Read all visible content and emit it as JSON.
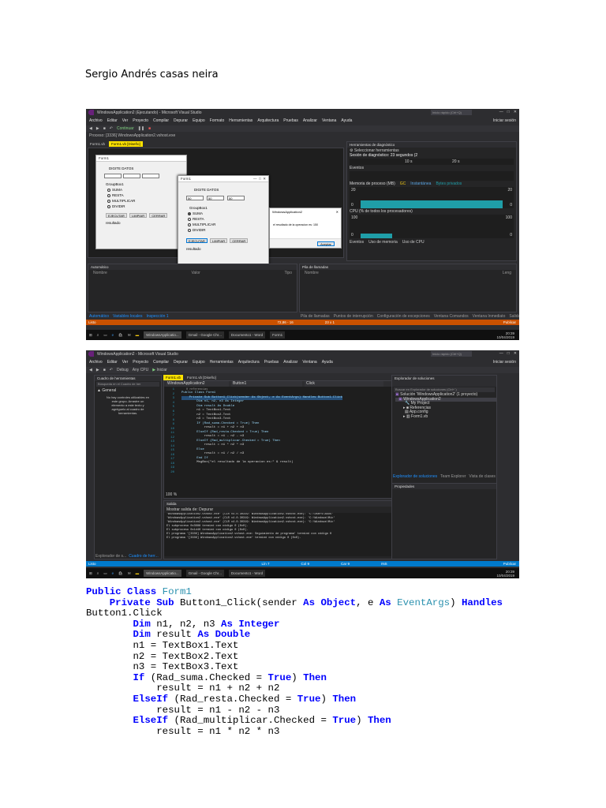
{
  "author": "Sergio Andrés casas neira",
  "shot1": {
    "title": "WindowsApplication2 (Ejecutando) - Microsoft Visual Studio",
    "menu": [
      "Archivo",
      "Editar",
      "Ver",
      "Proyecto",
      "Compilar",
      "Depurar",
      "Equipo",
      "Formato",
      "Herramientas",
      "Arquitectura",
      "Pruebas",
      "Analizar",
      "Ventana",
      "Ayuda"
    ],
    "quick_launch": "Inicio rápido (Ctrl+Q)",
    "user": "Iniciar sesión",
    "process": "Proceso: [3336] WindowsApplication2.vshost.exe",
    "continue": "Continuar",
    "form_tab": "Form1.vb",
    "form_design_tab": "Form1.vb [Diseño]",
    "form_small": {
      "title": "Form1",
      "heading": "DIGITE DATOS",
      "group": "GroupBox1",
      "radios": [
        "SUMA",
        "RESTA",
        "MULTIPLICAR",
        "DIVIDIR"
      ],
      "buttons": [
        "EJECUTAR",
        "LIMPIAR",
        "CERRAR"
      ],
      "result": "resultado"
    },
    "form_run": {
      "title": "Form1",
      "heading": "DIGITE DATOS",
      "values": [
        "50",
        "50",
        "50"
      ],
      "group": "GroupBox1",
      "radios": [
        "SUMA",
        "RESTA",
        "MULTIPLICAR",
        "DIVIDIR"
      ],
      "buttons": [
        "EJECUTAR",
        "LIMPIAR",
        "CERRAR"
      ],
      "result": "resultado"
    },
    "msgbox": {
      "title": "WindowsApplication2",
      "text": "el resultado de la operacion es: 150",
      "ok": "Aceptar"
    },
    "diag": {
      "title": "Herramientas de diagnóstico",
      "select_tools": "Seleccionar herramientas",
      "session": "Sesión de diagnóstico: 23 segundos (2",
      "t10": "10 s",
      "t20": "20 s",
      "events": "Eventos",
      "memory": "Memoria de proceso (MB)",
      "gc": "GC",
      "snapshot": "Instantánea",
      "private": "Bytes privados",
      "mem_left": "20",
      "mem_right": "20",
      "zero_left": "0",
      "zero_right": "0",
      "cpu": "CPU (% de todos los procesadores)",
      "cpu_left": "100",
      "cpu_right": "100",
      "cpu_zero_left": "0",
      "cpu_zero_right": "0",
      "tabs": [
        "Eventos",
        "Uso de memoria",
        "Uso de CPU"
      ]
    },
    "auto_title": "Automático",
    "auto_cols": [
      "Nombre",
      "Valor",
      "Tipo"
    ],
    "stack_title": "Pila de llamadas",
    "stack_cols": [
      "Nombre",
      "Leng"
    ],
    "bottom_tabs_left": [
      "Automático",
      "Variables locales",
      "Inspección 1"
    ],
    "bottom_tabs_right": [
      "Pila de llamadas",
      "Puntos de interrupción",
      "Configuración de excepciones",
      "Ventana Comandos",
      "Ventana Inmediato",
      "Salida"
    ],
    "status": "Listo",
    "status_pos": "72,86 - 16",
    "status_size": "23 x 1",
    "publish": "Publicar",
    "taskbar_apps": [
      "WindowsApplicatio...",
      "Gmail - Google Chr...",
      "Documento1 - Word",
      "Form1"
    ],
    "time": "20:39",
    "date": "10/04/2019"
  },
  "shot2": {
    "title": "WindowsApplication2 - Microsoft Visual Studio",
    "menu": [
      "Archivo",
      "Editar",
      "Ver",
      "Proyecto",
      "Compilar",
      "Depurar",
      "Equipo",
      "Herramientas",
      "Arquitectura",
      "Pruebas",
      "Analizar",
      "Ventana",
      "Ayuda"
    ],
    "quick_launch": "Inicio rápido (Ctrl+Q)",
    "user": "Iniciar sesión",
    "toolbar": [
      "Debug",
      "Any CPU",
      "Iniciar"
    ],
    "toolbox_title": "Cuadro de herramientas",
    "toolbox_search": "Búsqueda en el Cuadro de her",
    "toolbox_general": "General",
    "toolbox_msg": "No hay controles utilizables en este grupo. Arrastre un elemento a este texto y agréguelo al cuadro de herramientas.",
    "editor_tabs": [
      "Form1.vb",
      "Form1.vb [Diseño]"
    ],
    "nav_left": "WindowsApplication2",
    "nav_mid": "Button1",
    "nav_right": "Click",
    "refs": "0 referencias",
    "code_lines": [
      "Public Class Form1",
      "    Private Sub Button1_Click(sender As Object, e As EventArgs) Handles Button1.Click",
      "        Dim n1, n2, n3 As Integer",
      "        Dim result As Double",
      "        n1 = TextBox1.Text",
      "        n2 = TextBox2.Text",
      "        n3 = TextBox3.Text",
      "        If (Rad_suma.Checked = True) Then",
      "            result = n1 + n2 + n3",
      "        ElseIf (Rad_resta.Checked = True) Then",
      "            result = n1 - n2 - n3",
      "        ElseIf (Rad_multiplicar.Checked = True) Then",
      "            result = n1 * n2 * n3",
      "        Else",
      "            result = n1 / n2 / n3",
      "        End If",
      "        MsgBox(\"el resultado de la operacion es:\" & result)"
    ],
    "line_numbers": [
      "1",
      "2",
      "3",
      "4",
      "5",
      "6",
      "7",
      "8",
      "9",
      "10",
      "11",
      "12",
      "13",
      "14",
      "15",
      "16",
      "17",
      "18",
      "19",
      "20"
    ],
    "zoom": "100 %",
    "output_title": "Salida",
    "output_source": "Mostrar salida de: Depurar",
    "output_lines": [
      "'WindowsApplication2.vshost.exe' (CLR v4.0.30319: WindowsApplication2.vshost.exe): 'C:\\Users\\ASUS'",
      "'WindowsApplication2.vshost.exe' (CLR v4.0.30319: WindowsApplication2.vshost.exe): 'C:\\Windows\\Mic'",
      "'WindowsApplication2.vshost.exe' (CLR v4.0.30319: WindowsApplication2.vshost.exe): 'C:\\Windows\\Mic'",
      "El subproceso 0x3688 terminó con código 0 (0x0).",
      "El subproceso 0x1d40 terminó con código 0 (0x0).",
      "El programa '[3336] WindowsApplication2.vshost.exe: Seguimiento de programa' terminó con código 0",
      "El programa '[3336] WindowsApplication2.vshost.exe' terminó con código 0 (0x0)."
    ],
    "solution_title": "Explorador de soluciones",
    "solution_search": "Buscar en Explorador de soluciones (Ctrl+`)",
    "solution_items": [
      "Solución 'WindowsApplication2' (1 proyecto)",
      "WindowsApplication2",
      "My Project",
      "Referencias",
      "App.config",
      "Form1.vb"
    ],
    "solution_tabs": [
      "Explorador de soluciones",
      "Team Explorer",
      "Vista de clases"
    ],
    "props_title": "Propiedades",
    "left_tabs": [
      "Explorador de s...",
      "Cuadro de herr..."
    ],
    "status": "Listo",
    "status_ln": "Lín 7",
    "status_col": "Col 9",
    "status_car": "Car 9",
    "status_ins": "INS",
    "publish": "Publicar",
    "taskbar_apps": [
      "WindowsApplicatio...",
      "Gmail - Google Chr...",
      "Documento1 - Word"
    ],
    "time": "20:39",
    "date": "10/04/2019"
  },
  "listing": {
    "l1_kw": "Public Class",
    "l1_name": "Form1",
    "l2_kw1": "Private Sub",
    "l2_a": " Button1_Click(sender ",
    "l2_kw2": "As",
    "l2_t1": "Object",
    "l2_b": ", e ",
    "l2_kw3": "As",
    "l2_t2": "EventArgs",
    "l2_c": ") ",
    "l2_kw4": "Handles",
    "l3": "Button1.Click",
    "l4_kw": "Dim",
    "l4_a": " n1, n2, n3 ",
    "l4_kw2": "As Integer",
    "l5_kw": "Dim",
    "l5_a": " result ",
    "l5_kw2": "As Double",
    "l6": "n1 = TextBox1.Text",
    "l7": "n2 = TextBox2.Text",
    "l8": "n3 = TextBox3.Text",
    "l9_kw": "If",
    "l9_a": " (Rad_suma.Checked = ",
    "l9_kw2": "True",
    "l9_b": ") ",
    "l9_kw3": "Then",
    "l10": "result = n1 + n2 + n2",
    "l11_kw": "ElseIf",
    "l11_a": " (Rad_resta.Checked = ",
    "l11_kw2": "True",
    "l11_b": ") ",
    "l11_kw3": "Then",
    "l12": "result = n1 - n2 - n3",
    "l13_kw": "ElseIf",
    "l13_a": " (Rad_multiplicar.Checked = ",
    "l13_kw2": "True",
    "l13_b": ") ",
    "l13_kw3": "Then",
    "l14": "result = n1 * n2 * n3"
  }
}
